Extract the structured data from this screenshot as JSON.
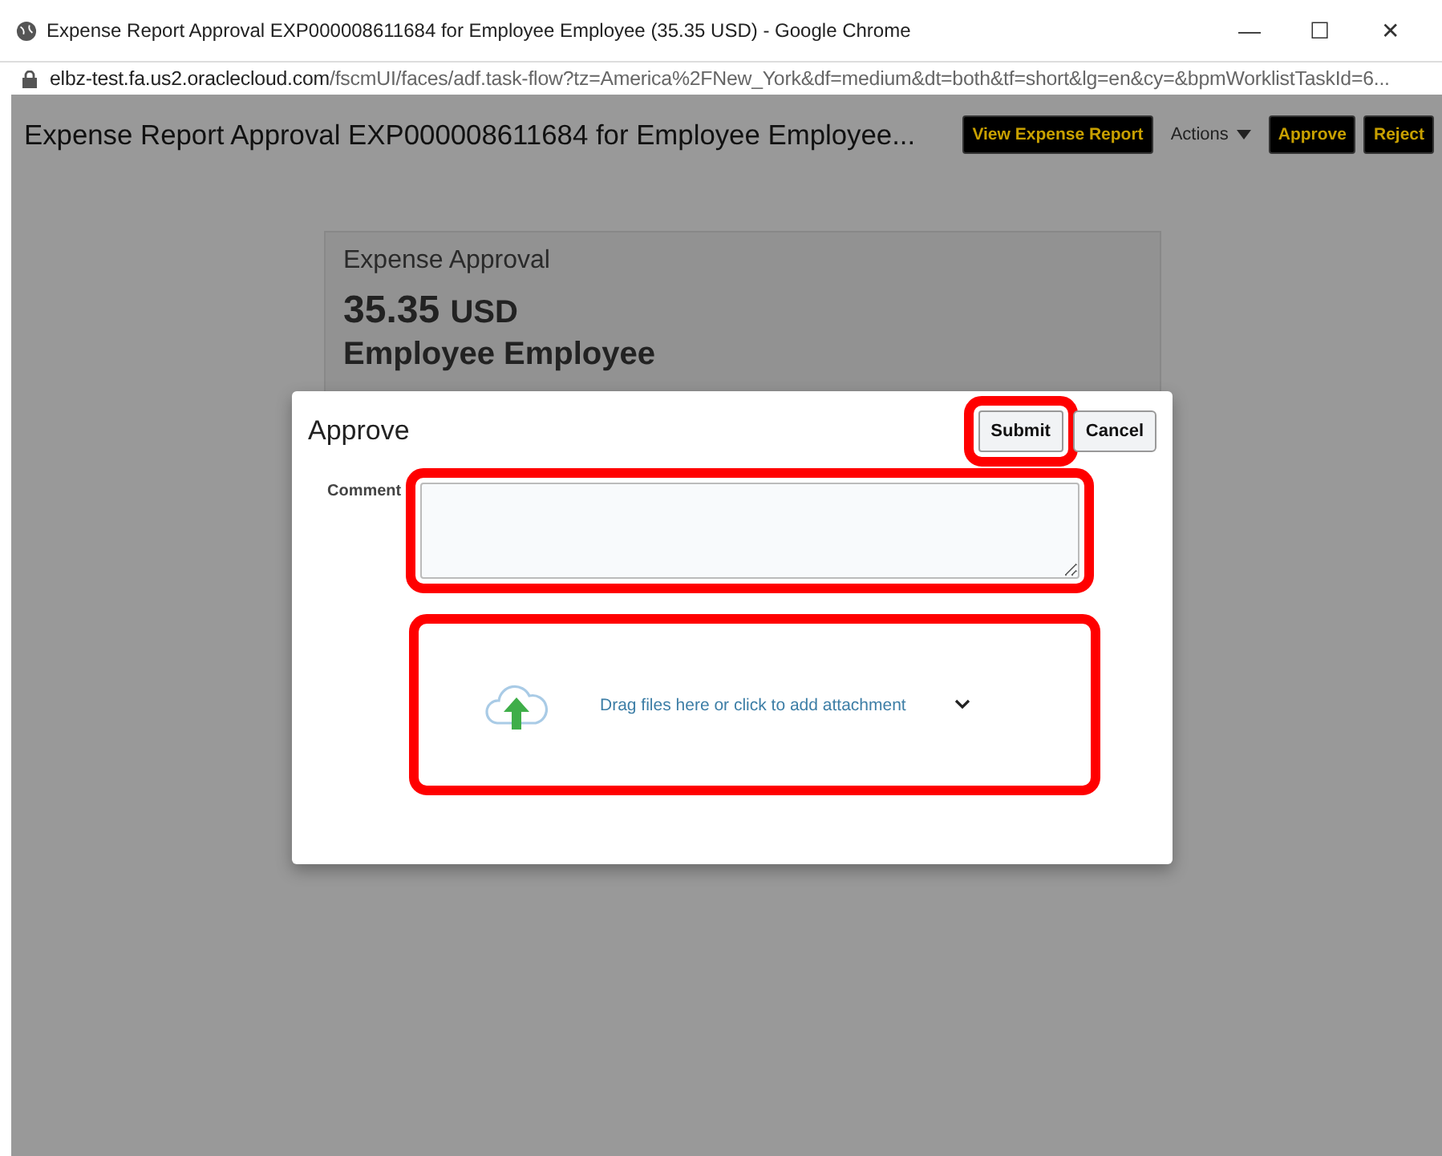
{
  "window": {
    "title": "Expense Report Approval EXP000008611684 for Employee Employee (35.35 USD) - Google Chrome",
    "controls": [
      "—",
      "☐",
      "✕"
    ]
  },
  "address_bar": {
    "host": "elbz-test.fa.us2.oraclecloud.com",
    "path": "/fscmUI/faces/adf.task-flow?tz=America%2FNew_York&df=medium&dt=both&tf=short&lg=en&cy=&bpmWorklistTaskId=6..."
  },
  "header": {
    "title": "Expense Report Approval EXP000008611684 for Employee Employee...",
    "actions": [
      {
        "kind": "button",
        "label": "View Expense Report"
      },
      {
        "kind": "menu",
        "label": "Actions"
      },
      {
        "kind": "button",
        "label": "Approve"
      },
      {
        "kind": "button",
        "label": "Reject"
      }
    ]
  },
  "card": {
    "heading": "Expense Approval",
    "amount": "35.35",
    "currency": "USD",
    "employee": "Employee Employee"
  },
  "dialog": {
    "title": "Approve",
    "buttons": [
      {
        "label": "Submit",
        "highlighted": true
      },
      {
        "label": "Cancel",
        "highlighted": false
      }
    ],
    "comment": {
      "label": "Comment",
      "highlighted": true
    },
    "dropzone": {
      "text": "Drag files here or click to add attachment",
      "highlighted": true
    }
  }
}
